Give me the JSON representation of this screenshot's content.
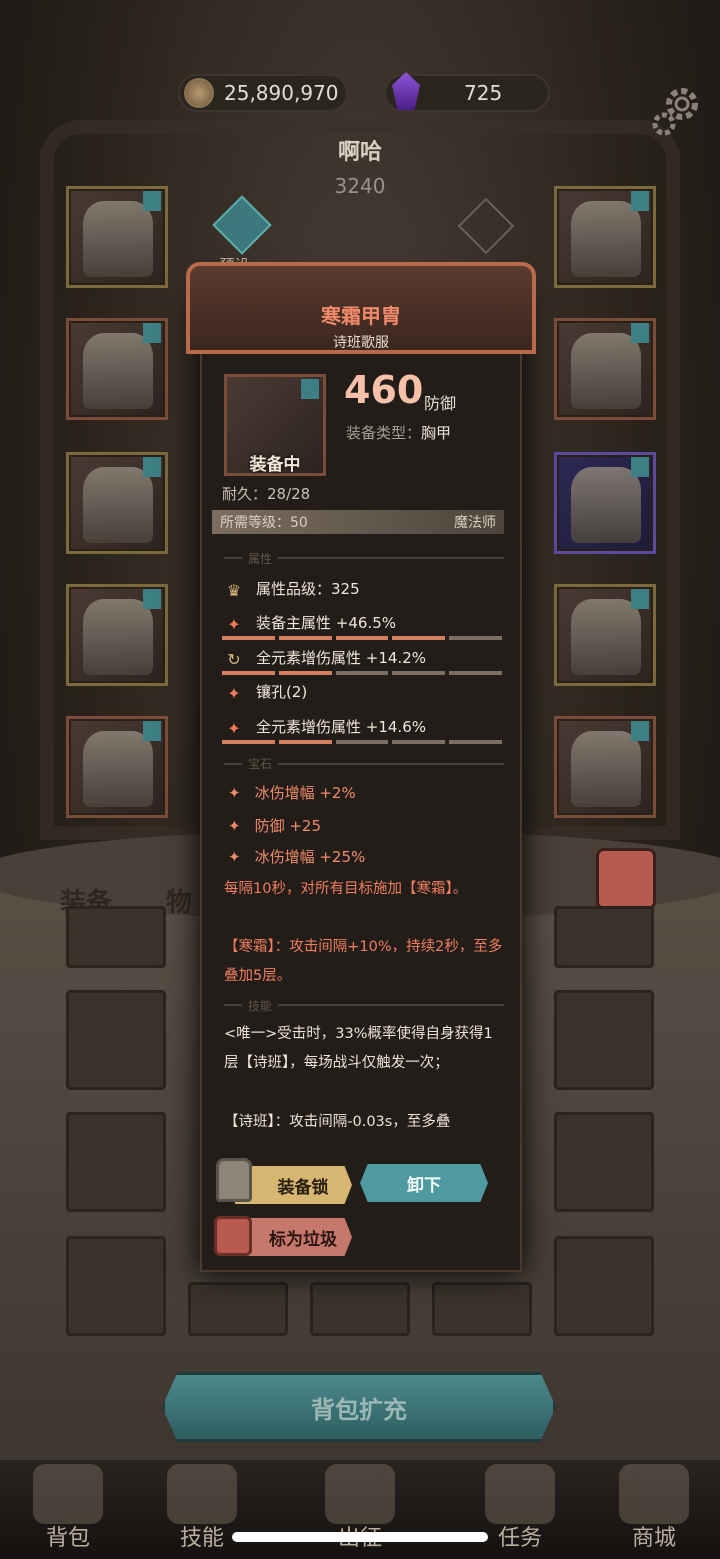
{
  "currency": {
    "coins": "25,890,970",
    "gems": "725"
  },
  "character": {
    "name": "啊哈",
    "power": "3240",
    "preset_label": "预设一"
  },
  "item": {
    "name": "寒霜甲胄",
    "subtitle": "诗班歌服",
    "status": "装备中",
    "defense_value": "460",
    "defense_label": "防御",
    "type_label": "装备类型：",
    "type_value": "胸甲",
    "durability": "耐久：28/28",
    "required_level": "所需等级：50",
    "class": "魔法师",
    "section_attr": "属性",
    "attr_grade": "属性品级：325",
    "attrs": [
      {
        "text": "装备主属性 +46.5%",
        "fill": 0.8
      },
      {
        "text": "全元素增伤属性 +14.2%",
        "fill": 0.4
      },
      {
        "text": "镶孔(2)",
        "fill": null
      },
      {
        "text": "全元素增伤属性 +14.6%",
        "fill": 0.4
      }
    ],
    "section_gem": "宝石",
    "gems": [
      "冰伤增幅 +2%",
      "防御 +25",
      "冰伤增幅 +25%"
    ],
    "set_effect_1": "每隔10秒，对所有目标施加【寒霜】。",
    "set_effect_2": "【寒霜】：攻击间隔+10%，持续2秒，至多叠加5层。",
    "section_skill": "技能",
    "skill_1": "<唯一>受击时，33%概率使得自身获得1层【诗班】，每场战斗仅触发一次；",
    "skill_2": "【诗班】：攻击间隔-0.03s，至多叠"
  },
  "buttons": {
    "lock": "装备锁",
    "unequip": "卸下",
    "trash": "标为垃圾",
    "expand": "背包扩充"
  },
  "bag_tabs": {
    "equip": "装备",
    "items": "物"
  },
  "nav": [
    "背包",
    "技能",
    "出征",
    "任务",
    "商城"
  ]
}
